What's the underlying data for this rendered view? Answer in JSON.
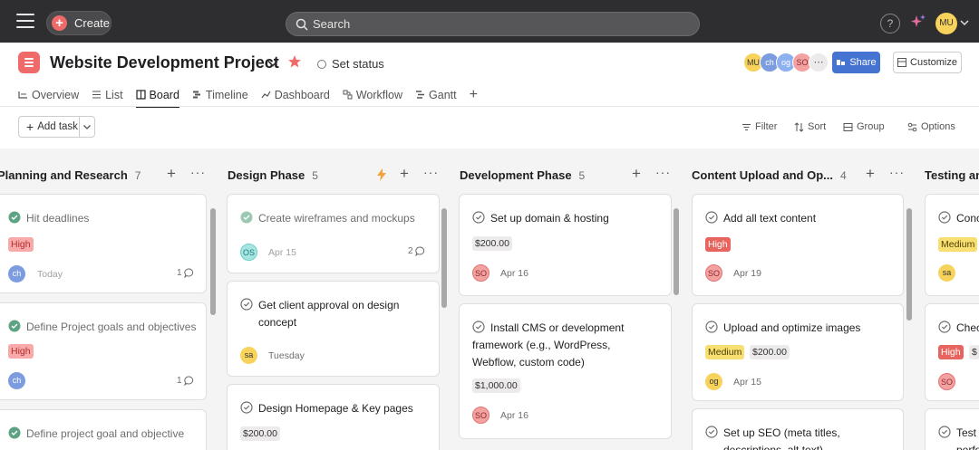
{
  "topbar": {
    "create_label": "Create",
    "search_placeholder": "Search",
    "help_glyph": "?",
    "me_initials": "MU"
  },
  "project": {
    "title": "Website Development Project",
    "set_status": "Set status",
    "share_label": "Share",
    "customize_label": "Customize",
    "members": [
      {
        "initials": "MU",
        "color": "#f7d35c"
      },
      {
        "initials": "ch",
        "color": "#7c9cdf"
      },
      {
        "initials": "og",
        "color": "#8db0f0"
      },
      {
        "initials": "SO",
        "color": "#f3a1a1"
      }
    ],
    "more_glyph": "⋯"
  },
  "tabs": [
    {
      "label": "Overview",
      "icon": "overview-icon"
    },
    {
      "label": "List",
      "icon": "list-icon"
    },
    {
      "label": "Board",
      "icon": "board-icon",
      "active": true
    },
    {
      "label": "Timeline",
      "icon": "timeline-icon"
    },
    {
      "label": "Dashboard",
      "icon": "dashboard-icon"
    },
    {
      "label": "Workflow",
      "icon": "workflow-icon"
    },
    {
      "label": "Gantt",
      "icon": "gantt-icon"
    }
  ],
  "toolbar": {
    "add_task": "Add task",
    "filter": "Filter",
    "sort": "Sort",
    "group": "Group",
    "options": "Options"
  },
  "columns": [
    {
      "title": "Planning and Research",
      "count": "7",
      "cards": [
        {
          "title": "Hit deadlines",
          "done": true,
          "tag": "High",
          "assignee": "ch",
          "date": "Today",
          "comments": "1"
        },
        {
          "title": "Define Project goals and objectives",
          "done": true,
          "tag": "High",
          "assignee": "ch",
          "comments": "1"
        },
        {
          "title": "Define project goal and objective",
          "done": true
        }
      ]
    },
    {
      "title": "Design Phase",
      "count": "5",
      "cards": [
        {
          "title": "Create wireframes and mockups",
          "done": true,
          "assignee": "OS",
          "date": "Apr 15",
          "comments": "2"
        },
        {
          "title": "Get client approval on design concept",
          "assignee": "sa",
          "date": "Tuesday"
        },
        {
          "title": "Design Homepage & Key pages",
          "price": "$200.00"
        }
      ]
    },
    {
      "title": "Development Phase",
      "count": "5",
      "cards": [
        {
          "title": "Set up domain & hosting",
          "price": "$200.00",
          "assignee": "SO",
          "date": "Apr 16"
        },
        {
          "title": "Install CMS or development framework (e.g., WordPress, Webflow, custom code)",
          "price": "$1,000.00",
          "assignee": "SO",
          "date": "Apr 16"
        }
      ]
    },
    {
      "title": "Content Upload and Op...",
      "count": "4",
      "cards": [
        {
          "title": "Add all text content",
          "tag": "High",
          "assignee": "SO",
          "date": "Apr 19"
        },
        {
          "title": "Upload and optimize images",
          "tag": "Medium",
          "price": "$200.00",
          "assignee": "og",
          "date": "Apr 15"
        },
        {
          "title": "Set up SEO (meta titles, descriptions, alt text)"
        }
      ]
    },
    {
      "title": "Testing an",
      "cards": [
        {
          "title": "Conc",
          "tag": "Medium",
          "assignee": "sa"
        },
        {
          "title": "Chec",
          "tag": "High",
          "price": "$",
          "assignee": "SO"
        },
        {
          "title": "Test w perform"
        }
      ]
    }
  ]
}
